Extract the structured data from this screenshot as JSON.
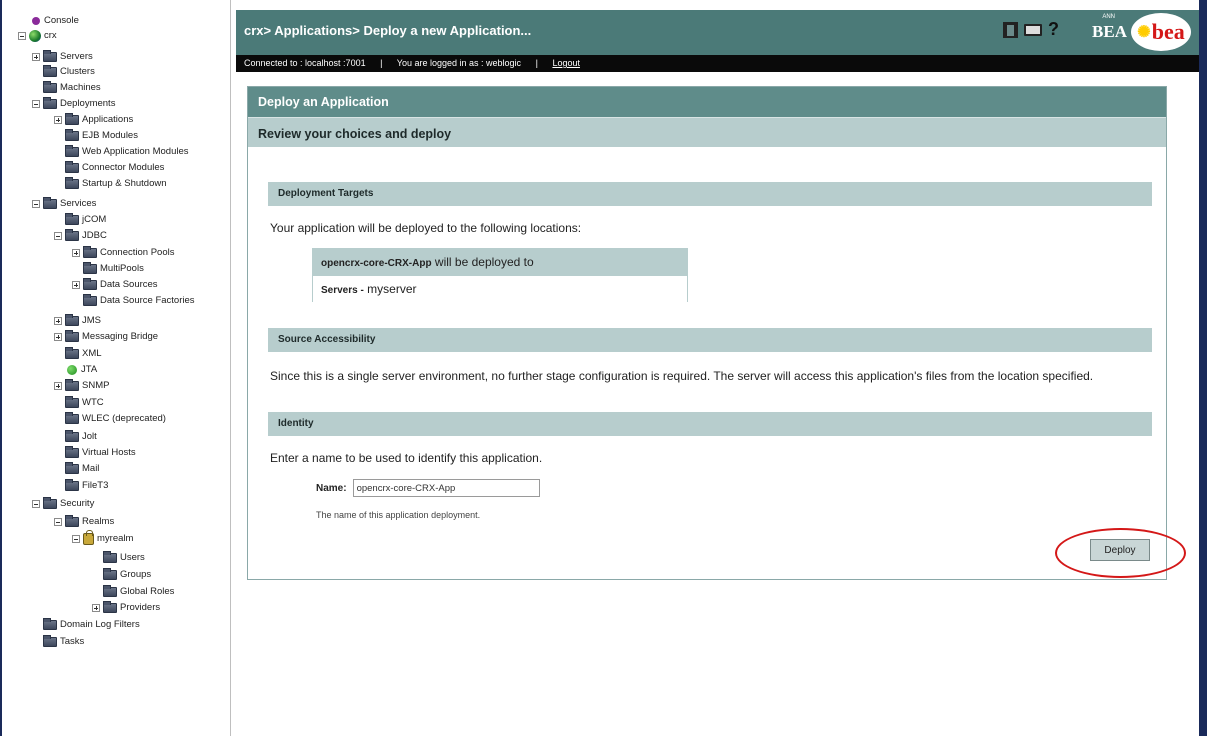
{
  "tree": {
    "items": [
      {
        "label": "Console",
        "icon": "console-dot-icon"
      },
      {
        "label": "crx",
        "icon": "globe-icon"
      },
      {
        "label": "Servers",
        "icon": "folder-icon"
      },
      {
        "label": "Clusters",
        "icon": "folder-icon"
      },
      {
        "label": "Machines",
        "icon": "folder-icon"
      },
      {
        "label": "Deployments",
        "icon": "folder-icon"
      },
      {
        "label": "Applications",
        "icon": "folder-icon"
      },
      {
        "label": "EJB Modules",
        "icon": "folder-icon"
      },
      {
        "label": "Web Application Modules",
        "icon": "folder-icon"
      },
      {
        "label": "Connector Modules",
        "icon": "folder-icon"
      },
      {
        "label": "Startup & Shutdown",
        "icon": "folder-icon"
      },
      {
        "label": "Services",
        "icon": "folder-icon"
      },
      {
        "label": "jCOM",
        "icon": "folder-icon"
      },
      {
        "label": "JDBC",
        "icon": "folder-icon"
      },
      {
        "label": "Connection Pools",
        "icon": "folder-icon"
      },
      {
        "label": "MultiPools",
        "icon": "folder-icon"
      },
      {
        "label": "Data Sources",
        "icon": "folder-icon"
      },
      {
        "label": "Data Source Factories",
        "icon": "folder-icon"
      },
      {
        "label": "JMS",
        "icon": "folder-icon"
      },
      {
        "label": "Messaging Bridge",
        "icon": "folder-icon"
      },
      {
        "label": "XML",
        "icon": "folder-icon"
      },
      {
        "label": "JTA",
        "icon": "jta-dot-icon"
      },
      {
        "label": "SNMP",
        "icon": "folder-icon"
      },
      {
        "label": "WTC",
        "icon": "folder-icon"
      },
      {
        "label": "WLEC (deprecated)",
        "icon": "folder-icon"
      },
      {
        "label": "Jolt",
        "icon": "folder-icon"
      },
      {
        "label": "Virtual Hosts",
        "icon": "folder-icon"
      },
      {
        "label": "Mail",
        "icon": "folder-icon"
      },
      {
        "label": "FileT3",
        "icon": "folder-icon"
      },
      {
        "label": "Security",
        "icon": "folder-icon"
      },
      {
        "label": "Realms",
        "icon": "folder-icon"
      },
      {
        "label": "myrealm",
        "icon": "lock-icon"
      },
      {
        "label": "Users",
        "icon": "folder-icon"
      },
      {
        "label": "Groups",
        "icon": "folder-icon"
      },
      {
        "label": "Global Roles",
        "icon": "folder-icon"
      },
      {
        "label": "Providers",
        "icon": "folder-icon"
      },
      {
        "label": "Domain Log Filters",
        "icon": "folder-icon"
      },
      {
        "label": "Tasks",
        "icon": "folder-icon"
      }
    ]
  },
  "header": {
    "breadcrumb": "crx> Applications> Deploy a new Application...",
    "brand_small": "ANN",
    "brand_text": "BEA",
    "logo_text": "bea",
    "icons": [
      "home-icon",
      "monitor-icon",
      "help-icon"
    ]
  },
  "status": {
    "connected": "Connected to : localhost :7001",
    "user": "You are logged in as : weblogic",
    "logout": "Logout"
  },
  "panel": {
    "title": "Deploy an Application",
    "subtitle": "Review your choices and deploy",
    "targets": {
      "header": "Deployment Targets",
      "text": "Your application will be deployed to the following locations:",
      "app_name": "opencrx-core-CRX-App",
      "deploy_suffix": "will be deployed to",
      "servers_label": "Servers -",
      "servers_value": "myserver"
    },
    "source": {
      "header": "Source Accessibility",
      "text": "Since this is a single server environment, no further stage configuration is required. The server will access this application's files from the location specified."
    },
    "identity": {
      "header": "Identity",
      "text": "Enter a name to be used to identify this application.",
      "name_label": "Name:",
      "name_value": "opencrx-core-CRX-App",
      "help": "The name of this application deployment."
    },
    "deploy_button": "Deploy"
  },
  "colors": {
    "header_bg": "#4b7a78",
    "title_bg": "#5f8c8a",
    "section_bg": "#b7cdcd",
    "annotation": "#d41818"
  }
}
